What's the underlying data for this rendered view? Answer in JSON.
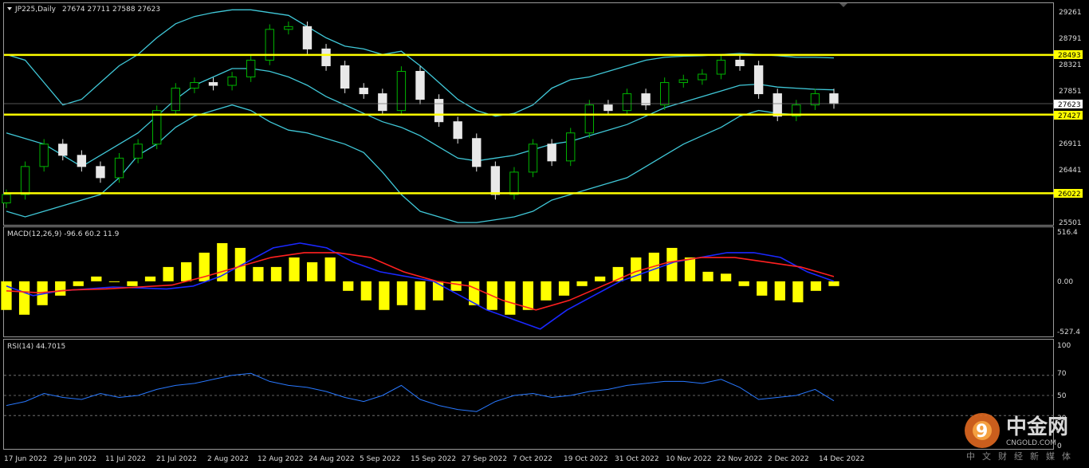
{
  "header": {
    "symbol": "JP225,Daily",
    "ohlc": "27674 27711 27588 27623"
  },
  "macd_label": "MACD(12,26,9) -96.6 60.2 11.9",
  "rsi_label": "RSI(14) 44.7015",
  "watermark": {
    "brand": "中金网",
    "domain": "CNGOLD.COM",
    "tagline": "中文财经新媒体"
  },
  "price_axis": {
    "ticks": [
      "29261",
      "28791",
      "28321",
      "27851",
      "26911",
      "26441",
      "25501"
    ],
    "highlighted": [
      {
        "label": "28493",
        "kind": "level"
      },
      {
        "label": "27623",
        "kind": "current"
      },
      {
        "label": "27427",
        "kind": "level"
      },
      {
        "label": "26022",
        "kind": "level"
      }
    ]
  },
  "macd_axis": {
    "ticks": [
      "516.4",
      "0.00",
      "-527.4"
    ]
  },
  "rsi_axis": {
    "ticks": [
      "100",
      "70",
      "50",
      "30",
      "0"
    ]
  },
  "colors": {
    "background": "#000000",
    "candle_up": "#00b400",
    "candle_down": "#e8e8e8",
    "bands": "#40c8d8",
    "levels": "#ffff00",
    "macd_hist": "#ffff00",
    "macd_line": "#1a28ff",
    "signal_line": "#ff2020",
    "rsi_line": "#2878ff",
    "grid": "#808080"
  },
  "chart_data": {
    "type": "line",
    "timeframe": "Daily",
    "x_labels": [
      "17 Jun 2022",
      "29 Jun 2022",
      "11 Jul 2022",
      "21 Jul 2022",
      "2 Aug 2022",
      "12 Aug 2022",
      "24 Aug 2022",
      "5 Sep 2022",
      "15 Sep 2022",
      "27 Sep 2022",
      "7 Oct 2022",
      "19 Oct 2022",
      "31 Oct 2022",
      "10 Nov 2022",
      "22 Nov 2022",
      "2 Dec 2022",
      "14 Dec 2022"
    ],
    "close": [
      26000,
      26500,
      26900,
      26700,
      26500,
      26300,
      26650,
      26900,
      27500,
      27900,
      28000,
      27950,
      28100,
      28400,
      28950,
      29000,
      28600,
      28300,
      27900,
      27800,
      27500,
      28200,
      27700,
      27300,
      27000,
      26500,
      26000,
      26400,
      26900,
      26600,
      27100,
      27600,
      27500,
      27800,
      27600,
      28000,
      28050,
      28150,
      28400,
      28300,
      27800,
      27400,
      27600,
      27800,
      27623
    ],
    "levels": [
      28493,
      27427,
      26022
    ],
    "bollinger": {
      "upper": [
        28500,
        28400,
        28000,
        27600,
        27700,
        28000,
        28300,
        28500,
        28800,
        29050,
        29180,
        29250,
        29300,
        29300,
        29250,
        29200,
        29000,
        28800,
        28650,
        28600,
        28500,
        28560,
        28300,
        28000,
        27700,
        27500,
        27400,
        27450,
        27600,
        27900,
        28050,
        28100,
        28200,
        28300,
        28400,
        28450,
        28470,
        28480,
        28500,
        28520,
        28500,
        28480,
        28450,
        28450,
        28440
      ],
      "middle": [
        27100,
        27000,
        26900,
        26700,
        26500,
        26700,
        26900,
        27100,
        27400,
        27700,
        27950,
        28100,
        28250,
        28250,
        28200,
        28100,
        27950,
        27750,
        27600,
        27450,
        27300,
        27200,
        27050,
        26850,
        26650,
        26600,
        26650,
        26700,
        26800,
        26900,
        26950,
        27050,
        27150,
        27250,
        27400,
        27550,
        27650,
        27750,
        27850,
        27950,
        27970,
        27920,
        27900,
        27880,
        27870
      ],
      "lower": [
        25700,
        25600,
        25700,
        25800,
        25900,
        26000,
        26300,
        26700,
        26900,
        27200,
        27400,
        27500,
        27600,
        27500,
        27300,
        27150,
        27100,
        27000,
        26900,
        26750,
        26400,
        26000,
        25700,
        25600,
        25500,
        25500,
        25550,
        25600,
        25700,
        25900,
        26000,
        26100,
        26200,
        26300,
        26500,
        26700,
        26900,
        27050,
        27200,
        27400,
        27500,
        27450,
        27430,
        27420,
        27420
      ]
    },
    "macd": {
      "ylim": [
        -527.4,
        516.4
      ],
      "histogram": [
        -300,
        -350,
        -250,
        -150,
        -50,
        50,
        0,
        -50,
        50,
        150,
        200,
        300,
        400,
        350,
        150,
        150,
        250,
        200,
        250,
        -100,
        -200,
        -300,
        -250,
        -300,
        -200,
        -100,
        -250,
        -300,
        -350,
        -300,
        -200,
        -150,
        -50,
        50,
        150,
        250,
        300,
        350,
        250,
        100,
        80,
        -50,
        -150,
        -200,
        -220,
        -100,
        -50
      ],
      "macd": [
        -50,
        -150,
        -100,
        -80,
        -60,
        -70,
        -80,
        -50,
        50,
        200,
        350,
        400,
        350,
        200,
        100,
        50,
        0,
        -150,
        -300,
        -400,
        -500,
        -300,
        -150,
        0,
        100,
        200,
        250,
        300,
        300,
        250,
        100,
        0
      ],
      "signal": [
        -100,
        -120,
        -90,
        -80,
        -60,
        -40,
        50,
        150,
        250,
        300,
        300,
        250,
        100,
        0,
        -50,
        -200,
        -300,
        -200,
        -50,
        100,
        200,
        250,
        250,
        200,
        150,
        50
      ]
    },
    "rsi": {
      "ylim": [
        0,
        100
      ],
      "reference_levels": [
        70,
        50,
        30
      ],
      "values": [
        40,
        44,
        52,
        48,
        46,
        52,
        48,
        50,
        56,
        60,
        62,
        66,
        70,
        72,
        64,
        60,
        58,
        54,
        48,
        44,
        50,
        60,
        46,
        40,
        36,
        34,
        44,
        50,
        52,
        48,
        50,
        54,
        56,
        60,
        62,
        64,
        64,
        62,
        66,
        58,
        46,
        48,
        50,
        56,
        44.7
      ]
    }
  }
}
